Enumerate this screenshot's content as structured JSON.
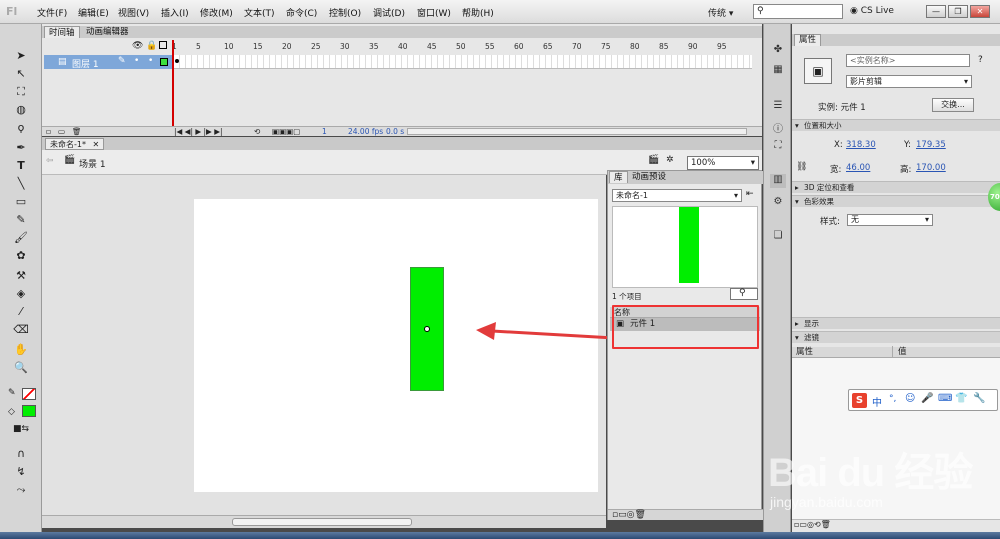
{
  "app": {
    "logo": "Fl"
  },
  "menu": [
    "文件(F)",
    "编辑(E)",
    "视图(V)",
    "插入(I)",
    "修改(M)",
    "文本(T)",
    "命令(C)",
    "控制(O)",
    "调试(D)",
    "窗口(W)",
    "帮助(H)"
  ],
  "titlebar": {
    "workspace": "传统 ▾",
    "cslive": "CS Live",
    "window_buttons": [
      "—",
      "❐",
      "✕"
    ]
  },
  "timeline": {
    "tabs": [
      "时间轴",
      "动画编辑器"
    ],
    "frame_numbers": [
      "1",
      "5",
      "10",
      "15",
      "20",
      "25",
      "30",
      "35",
      "40",
      "45",
      "50",
      "55",
      "60",
      "65",
      "70",
      "75",
      "80",
      "85",
      "90",
      "95"
    ],
    "layer_name": "图层 1",
    "footer": {
      "frame": "1",
      "fps": "24.00 fps",
      "time": "0.0 s"
    }
  },
  "document": {
    "tab": "未命名-1*",
    "scene": "场景 1",
    "zoom": "100%"
  },
  "stage": {
    "object_color": "#00ee00"
  },
  "library": {
    "tabs": [
      "库",
      "动画预设"
    ],
    "doc_select": "未命名-1",
    "item_count": "1 个项目",
    "column_name": "名称",
    "items": [
      {
        "name": "元件 1"
      }
    ]
  },
  "properties": {
    "tab": "属性",
    "instance_name_placeholder": "<实例名称>",
    "type": "影片剪辑",
    "instance_label": "实例: 元件 1",
    "swap_button": "交换...",
    "sections": {
      "position_size": "位置和大小",
      "three_d": "3D 定位和查看",
      "color_effect": "色彩效果",
      "display": "显示",
      "filters": "滤镜"
    },
    "x_label": "X:",
    "x_value": "318.30",
    "y_label": "Y:",
    "y_value": "179.35",
    "w_label": "宽:",
    "w_value": "46.00",
    "h_label": "高:",
    "h_value": "170.00",
    "style_label": "样式:",
    "style_value": "无",
    "filter_col_property": "属性",
    "filter_col_value": "值"
  },
  "ime": {
    "logo": "S",
    "items": [
      "中",
      "°,",
      "☺",
      "🎤",
      "⌨",
      "👕",
      "🔧"
    ]
  },
  "badge": {
    "text": "70"
  },
  "watermark": {
    "brand": "Bai du 经验",
    "url": "jingyan.baidu.com"
  }
}
